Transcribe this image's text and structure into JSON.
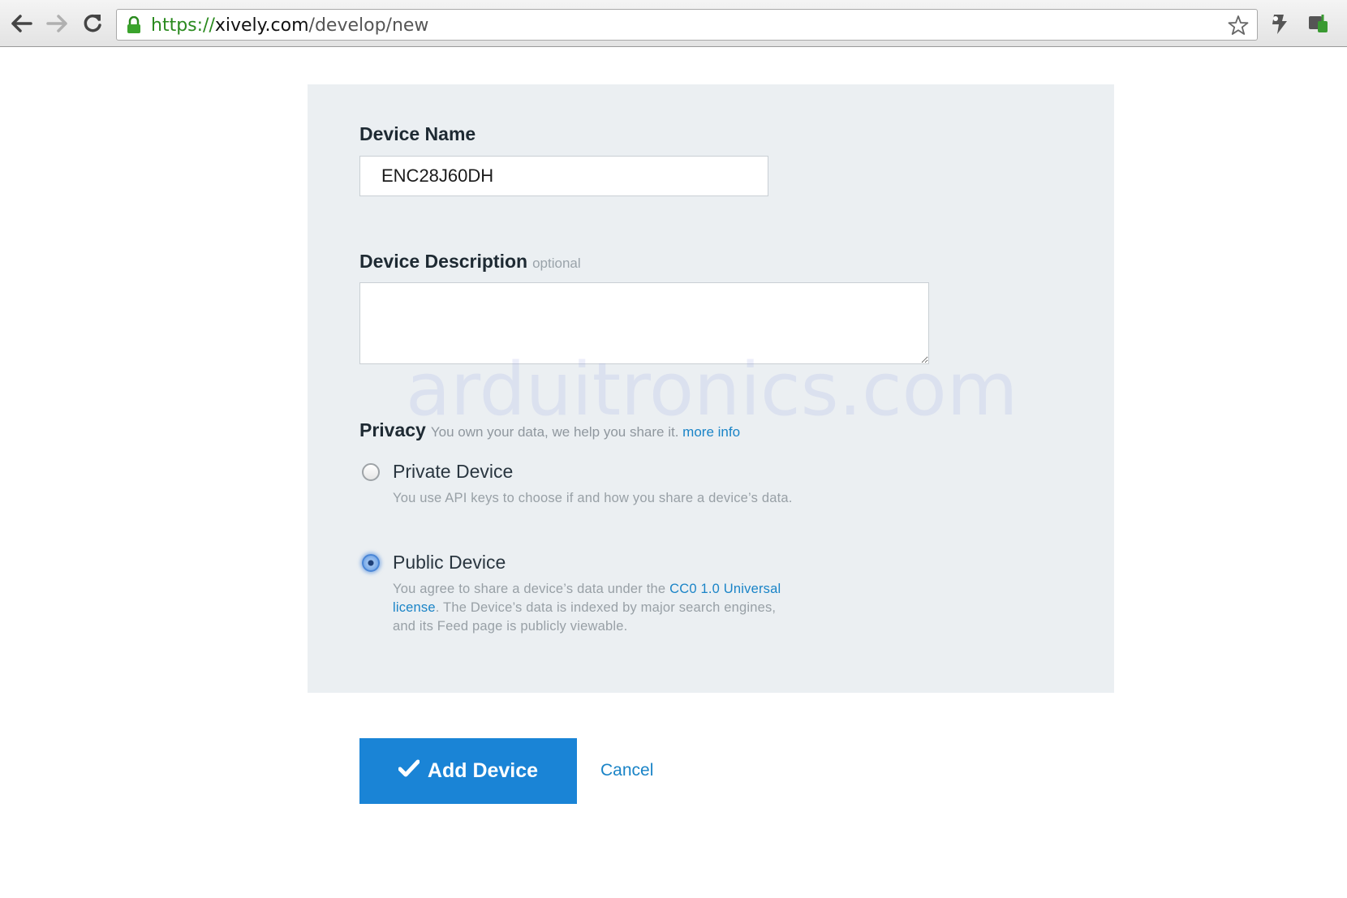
{
  "browser": {
    "url_scheme": "https://",
    "url_host": "xively.com",
    "url_path": "/develop/new",
    "icons": {
      "back": "back-arrow-icon",
      "forward": "forward-arrow-icon",
      "reload": "reload-icon",
      "secure": "lock-icon",
      "bookmark": "star-icon",
      "extension1": "extension-icon",
      "extension2": "extension-puzzle-icon"
    }
  },
  "form": {
    "device_name": {
      "label": "Device Name",
      "value": "ENC28J60DH"
    },
    "device_description": {
      "label": "Device Description",
      "optional_text": "optional",
      "value": ""
    },
    "privacy": {
      "label": "Privacy",
      "note": "You own your data, we help you share it.",
      "more_info": "more info",
      "options": [
        {
          "title": "Private Device",
          "selected": false,
          "description": "You use API keys to choose if and how you share a device’s data."
        },
        {
          "title": "Public Device",
          "selected": true,
          "description_before_link": "You agree to share a device’s data under the ",
          "link_text": "CC0 1.0 Universal license",
          "description_after_link": ". The Device’s data is indexed by major search engines, and its Feed page is publicly viewable."
        }
      ]
    }
  },
  "actions": {
    "submit_label": "Add Device",
    "cancel_label": "Cancel",
    "submit_icon": "checkmark-icon"
  },
  "watermark": "arduitronics.com",
  "colors": {
    "accent": "#1a84d6",
    "link": "#1a84c7",
    "panel_bg": "#ebeff2"
  }
}
